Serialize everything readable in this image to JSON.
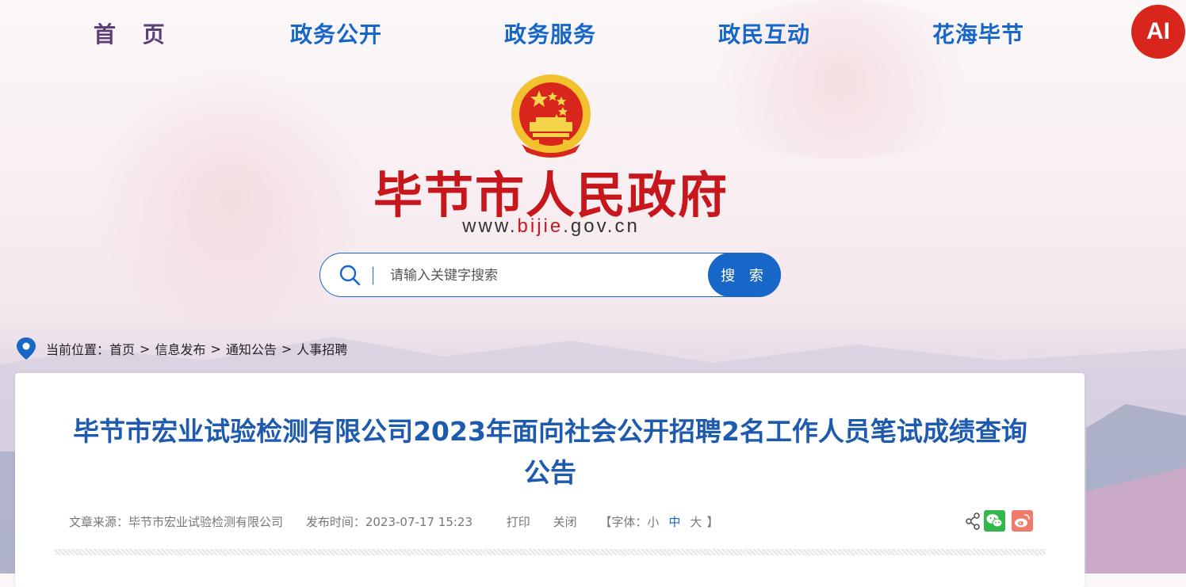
{
  "nav": {
    "items": [
      {
        "label": "首 页"
      },
      {
        "label": "政务公开"
      },
      {
        "label": "政务服务"
      },
      {
        "label": "政民互动"
      },
      {
        "label": "花海毕节"
      }
    ],
    "ai_label": "AI"
  },
  "header": {
    "site_title": "毕节市人民政府",
    "url_prefix": "www.",
    "url_highlight": "bijie",
    "url_suffix": ".gov.cn"
  },
  "search": {
    "placeholder": "请输入关键字搜索",
    "button_label": "搜 索"
  },
  "breadcrumb": {
    "prefix": "当前位置：",
    "items": [
      "首页",
      "信息发布",
      "通知公告",
      "人事招聘"
    ],
    "separator": ">"
  },
  "article": {
    "title": "毕节市宏业试验检测有限公司2023年面向社会公开招聘2名工作人员笔试成绩查询公告",
    "source_label": "文章来源：",
    "source": "毕节市宏业试验检测有限公司",
    "time_label": "发布时间：",
    "time": "2023-07-17 15:23",
    "print_label": "打印",
    "close_label": "关闭",
    "font_open": "【字体：",
    "font_small": "小",
    "font_medium": "中",
    "font_large": "大",
    "font_close": "】"
  },
  "colors": {
    "brand_blue": "#1667c8",
    "title_red": "#c8161d",
    "wechat_green": "#32b848",
    "weibo_red": "#f07a6c"
  }
}
